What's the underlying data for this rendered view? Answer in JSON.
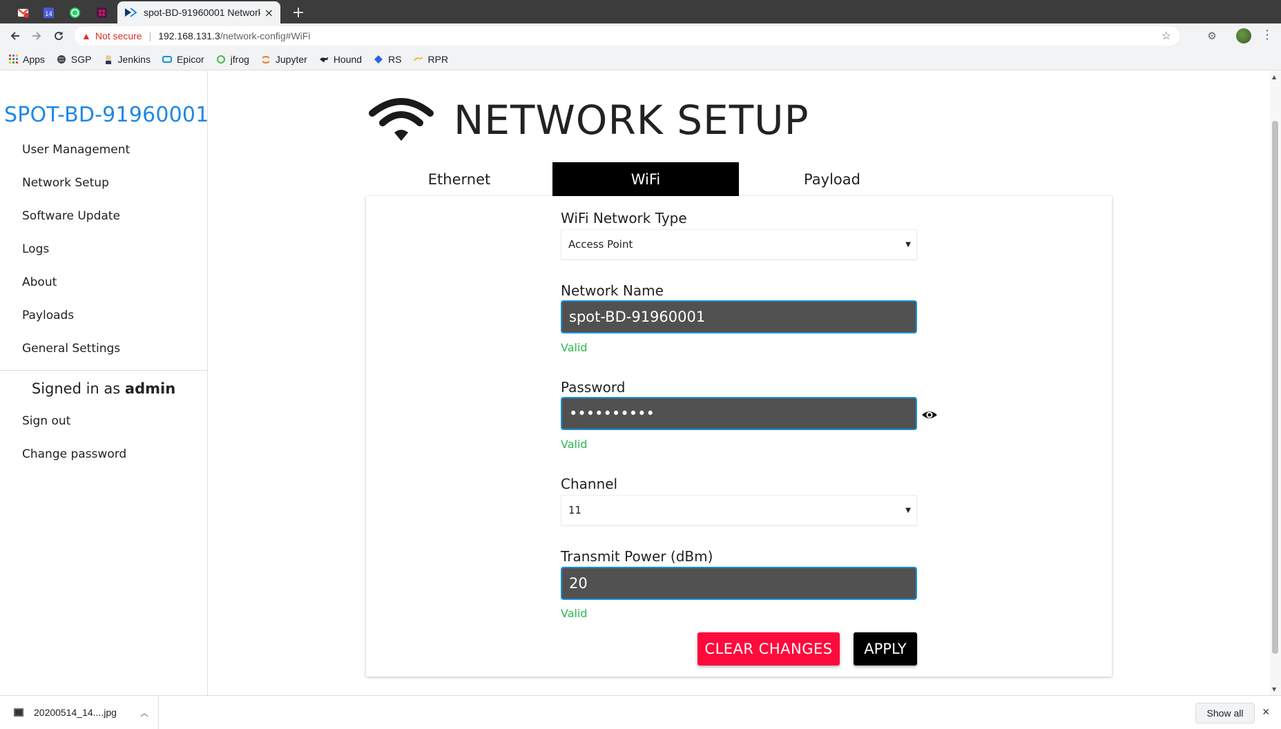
{
  "browser": {
    "pinned_tabs": [
      {
        "icon": "gmail-icon",
        "color": "#ea4335"
      },
      {
        "icon": "calendar-icon",
        "color": "#4a5ad8",
        "text": "14"
      },
      {
        "icon": "whatsapp-icon",
        "color": "#25d366"
      },
      {
        "icon": "slack-icon",
        "color": "#4a154b"
      }
    ],
    "active_tab_title": "spot-BD-91960001 Network",
    "active_tab_close": "×",
    "new_tab": "+",
    "security_label": "Not secure",
    "url_host": "192.168.131.3",
    "url_path": "/network-config#WiFi",
    "bookmarks": [
      {
        "label": "Apps",
        "icon": "apps-grid-icon"
      },
      {
        "label": "SGP",
        "icon": "globe-icon"
      },
      {
        "label": "Jenkins",
        "icon": "jenkins-icon"
      },
      {
        "label": "Epicor",
        "icon": "epicor-icon"
      },
      {
        "label": "jfrog",
        "icon": "jfrog-icon"
      },
      {
        "label": "Jupyter",
        "icon": "jupyter-icon"
      },
      {
        "label": "Hound",
        "icon": "hound-icon"
      },
      {
        "label": "RS",
        "icon": "rs-icon"
      },
      {
        "label": "RPR",
        "icon": "rpr-icon"
      }
    ]
  },
  "sidebar": {
    "device_name": "SPOT-BD-91960001",
    "items": [
      {
        "label": "User Management"
      },
      {
        "label": "Network Setup"
      },
      {
        "label": "Software Update"
      },
      {
        "label": "Logs"
      },
      {
        "label": "About"
      },
      {
        "label": "Payloads"
      },
      {
        "label": "General Settings"
      }
    ],
    "signed_in_prefix": "Signed in as",
    "signed_in_user": "admin",
    "account_items": [
      {
        "label": "Sign out"
      },
      {
        "label": "Change password"
      }
    ]
  },
  "main": {
    "title": "NETWORK SETUP",
    "tabs": [
      {
        "label": "Ethernet",
        "active": false
      },
      {
        "label": "WiFi",
        "active": true
      },
      {
        "label": "Payload",
        "active": false
      }
    ],
    "form": {
      "network_type_label": "WiFi Network Type",
      "network_type_value": "Access Point",
      "network_name_label": "Network Name",
      "network_name_value": "spot-BD-91960001",
      "network_name_status": "Valid",
      "password_label": "Password",
      "password_value": "••••••••••",
      "password_status": "Valid",
      "channel_label": "Channel",
      "channel_value": "11",
      "tx_power_label": "Transmit Power (dBm)",
      "tx_power_value": "20",
      "tx_power_status": "Valid",
      "clear_button": "CLEAR CHANGES",
      "apply_button": "APPLY"
    },
    "colors": {
      "accent_blue": "#1e88e5",
      "valid_green": "#2db84d",
      "clear_red": "#ff0a3c",
      "active_tab_bg": "#000000",
      "input_bg": "#515151"
    }
  },
  "download_bar": {
    "file_name": "20200514_14....jpg",
    "show_all": "Show all",
    "close": "×"
  }
}
